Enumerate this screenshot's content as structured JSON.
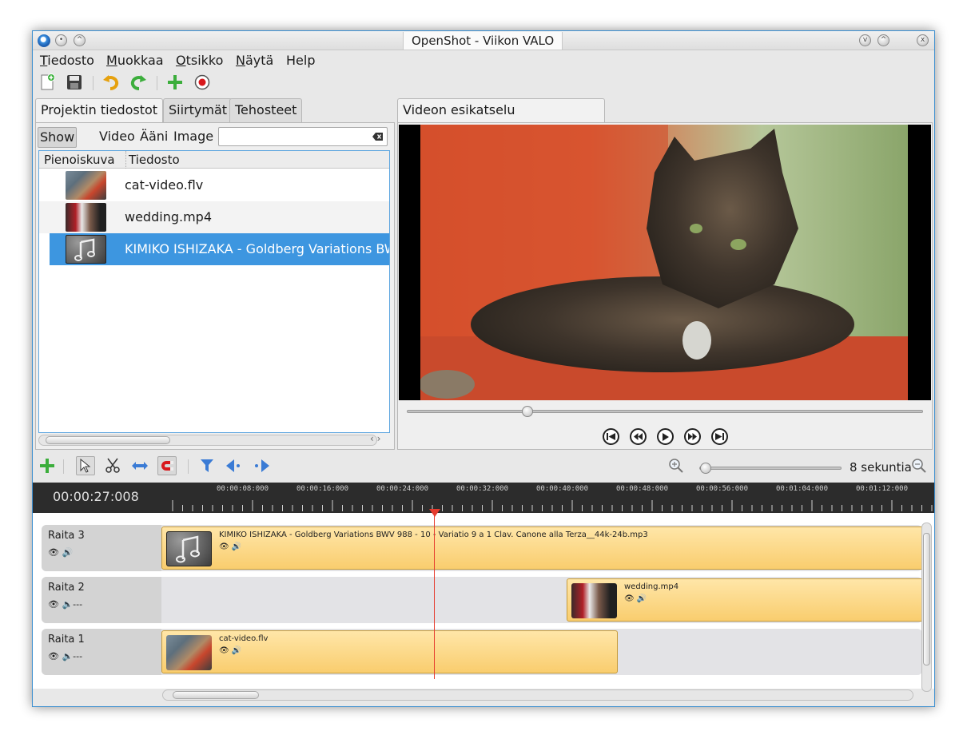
{
  "window": {
    "title": "OpenShot - Viikon VALO"
  },
  "menu": [
    {
      "label": "Tiedosto",
      "accel": "T",
      "rest": "iedosto"
    },
    {
      "label": "Muokkaa",
      "accel": "M",
      "rest": "uokkaa"
    },
    {
      "label": "Otsikko",
      "accel": "O",
      "rest": "tsikko"
    },
    {
      "label": "Näytä",
      "accel": "N",
      "rest": "äytä"
    },
    {
      "label": "Help",
      "accel": "",
      "rest": "Help"
    }
  ],
  "left_tabs": [
    "Projektin tiedostot",
    "Siirtymät",
    "Tehosteet"
  ],
  "filters": [
    "Show All",
    "Video",
    "Ääni",
    "Image"
  ],
  "search": {
    "value": "",
    "placeholder": ""
  },
  "file_list": {
    "columns": [
      "Pienoiskuva",
      "Tiedosto"
    ],
    "rows": [
      {
        "name": "cat-video.flv",
        "thumb": "cat"
      },
      {
        "name": "wedding.mp4",
        "thumb": "wedding"
      },
      {
        "name": "KIMIKO ISHIZAKA - Goldberg Variations BWV",
        "thumb": "music",
        "selected": true
      }
    ]
  },
  "preview": {
    "tab": "Videon esikatselu (keskeytetty)",
    "seek_fraction": 0.22
  },
  "timeline": {
    "current_time": "00:00:27:008",
    "zoom_label": "8 sekuntia",
    "ticks": [
      "00:00:08:000",
      "00:00:16:000",
      "00:00:24:000",
      "00:00:32:000",
      "00:00:40:000",
      "00:00:48:000",
      "00:00:56:000",
      "00:01:04:000",
      "00:01:12:000"
    ],
    "tracks": [
      {
        "name": "Raita 3",
        "audio": "on",
        "clips": [
          {
            "title": "KIMIKO ISHIZAKA - Goldberg Variations BWV 988 - 10 - Variatio 9 a 1 Clav. Canone alla Terza__44k-24b.mp3",
            "thumb": "music"
          }
        ]
      },
      {
        "name": "Raita 2",
        "audio": "muted",
        "clips": [
          {
            "title": "wedding.mp4",
            "thumb": "wedding"
          }
        ]
      },
      {
        "name": "Raita 1",
        "audio": "muted",
        "clips": [
          {
            "title": "cat-video.flv",
            "thumb": "cat"
          }
        ]
      }
    ]
  },
  "colors": {
    "accent": "#3d96e0",
    "clip": "#f9cd6e",
    "playhead": "#e63b2e",
    "ruler": "#2c2c2c"
  }
}
